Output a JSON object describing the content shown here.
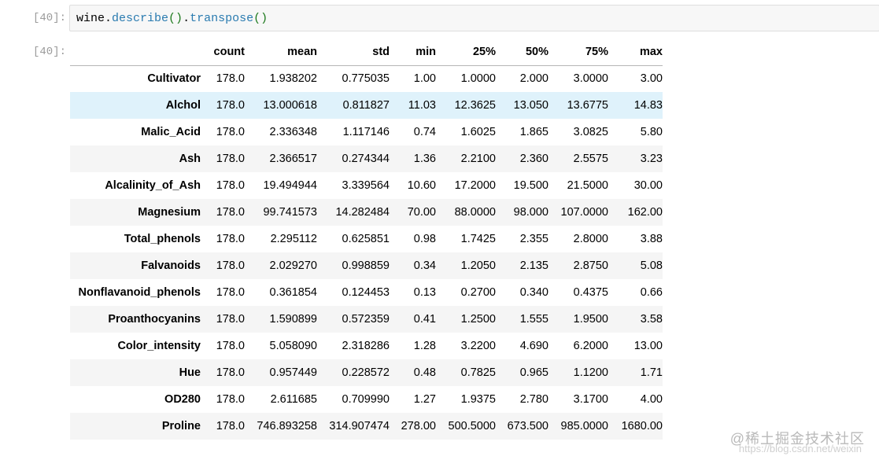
{
  "input_cell": {
    "prompt": "[40]:",
    "code": {
      "var": "wine",
      "dot1": ".",
      "call1": "describe",
      "paren1": "()",
      "dot2": ".",
      "call2": "transpose",
      "paren2": "()"
    }
  },
  "output_cell": {
    "prompt": "[40]:",
    "table": {
      "columns": [
        "count",
        "mean",
        "std",
        "min",
        "25%",
        "50%",
        "75%",
        "max"
      ],
      "rows": [
        {
          "index": "Cultivator",
          "values": [
            "178.0",
            "1.938202",
            "0.775035",
            "1.00",
            "1.0000",
            "2.000",
            "3.0000",
            "3.00"
          ]
        },
        {
          "index": "Alchol",
          "values": [
            "178.0",
            "13.000618",
            "0.811827",
            "11.03",
            "12.3625",
            "13.050",
            "13.6775",
            "14.83"
          ]
        },
        {
          "index": "Malic_Acid",
          "values": [
            "178.0",
            "2.336348",
            "1.117146",
            "0.74",
            "1.6025",
            "1.865",
            "3.0825",
            "5.80"
          ]
        },
        {
          "index": "Ash",
          "values": [
            "178.0",
            "2.366517",
            "0.274344",
            "1.36",
            "2.2100",
            "2.360",
            "2.5575",
            "3.23"
          ]
        },
        {
          "index": "Alcalinity_of_Ash",
          "values": [
            "178.0",
            "19.494944",
            "3.339564",
            "10.60",
            "17.2000",
            "19.500",
            "21.5000",
            "30.00"
          ]
        },
        {
          "index": "Magnesium",
          "values": [
            "178.0",
            "99.741573",
            "14.282484",
            "70.00",
            "88.0000",
            "98.000",
            "107.0000",
            "162.00"
          ]
        },
        {
          "index": "Total_phenols",
          "values": [
            "178.0",
            "2.295112",
            "0.625851",
            "0.98",
            "1.7425",
            "2.355",
            "2.8000",
            "3.88"
          ]
        },
        {
          "index": "Falvanoids",
          "values": [
            "178.0",
            "2.029270",
            "0.998859",
            "0.34",
            "1.2050",
            "2.135",
            "2.8750",
            "5.08"
          ]
        },
        {
          "index": "Nonflavanoid_phenols",
          "values": [
            "178.0",
            "0.361854",
            "0.124453",
            "0.13",
            "0.2700",
            "0.340",
            "0.4375",
            "0.66"
          ]
        },
        {
          "index": "Proanthocyanins",
          "values": [
            "178.0",
            "1.590899",
            "0.572359",
            "0.41",
            "1.2500",
            "1.555",
            "1.9500",
            "3.58"
          ]
        },
        {
          "index": "Color_intensity",
          "values": [
            "178.0",
            "5.058090",
            "2.318286",
            "1.28",
            "3.2200",
            "4.690",
            "6.2000",
            "13.00"
          ]
        },
        {
          "index": "Hue",
          "values": [
            "178.0",
            "0.957449",
            "0.228572",
            "0.48",
            "0.7825",
            "0.965",
            "1.1200",
            "1.71"
          ]
        },
        {
          "index": "OD280",
          "values": [
            "178.0",
            "2.611685",
            "0.709990",
            "1.27",
            "1.9375",
            "2.780",
            "3.1700",
            "4.00"
          ]
        },
        {
          "index": "Proline",
          "values": [
            "178.0",
            "746.893258",
            "314.907474",
            "278.00",
            "500.5000",
            "673.500",
            "985.0000",
            "1680.00"
          ]
        }
      ],
      "highlighted_row": "Alchol"
    }
  },
  "watermark": {
    "text": "@稀土掘金技术社区",
    "url": "https://blog.csdn.net/weixin"
  },
  "colors": {
    "prompt": "#9c9c9c",
    "code_call": "#2a7bb0",
    "code_paren": "#1d7a1d",
    "row_highlight": "#dff2fb",
    "row_stripe": "#f5f5f5"
  }
}
